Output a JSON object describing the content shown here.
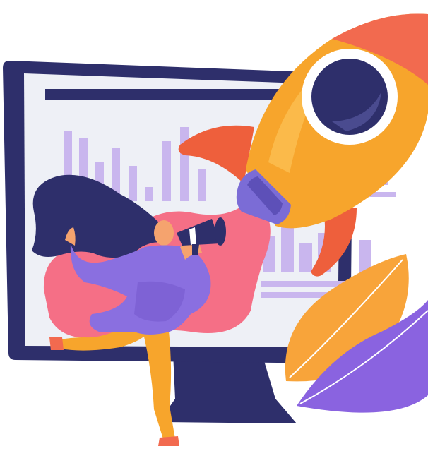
{
  "colors": {
    "monitor_frame": "#2e2f6b",
    "screen": "#eef0f6",
    "chart_bars": "#c9b6ee",
    "rocket_body": "#f7a52c",
    "rocket_top": "#f26a4f",
    "rocket_fin": "#ee5f3c",
    "porthole_ring": "#ffffff",
    "porthole_glass": "#2e2f6b",
    "nozzle": "#7b6cd6",
    "exhaust": "#f56f86",
    "hair": "#2e2f6b",
    "top": "#8a6fe0",
    "pants": "#f7a52c",
    "skin": "#f5a36e",
    "leaf_orange": "#f8a43a",
    "leaf_purple": "#8a63e0"
  },
  "icons": [
    "rocket-icon",
    "monitor-icon",
    "bar-chart-icon",
    "megaphone-icon",
    "leaf-icon"
  ]
}
